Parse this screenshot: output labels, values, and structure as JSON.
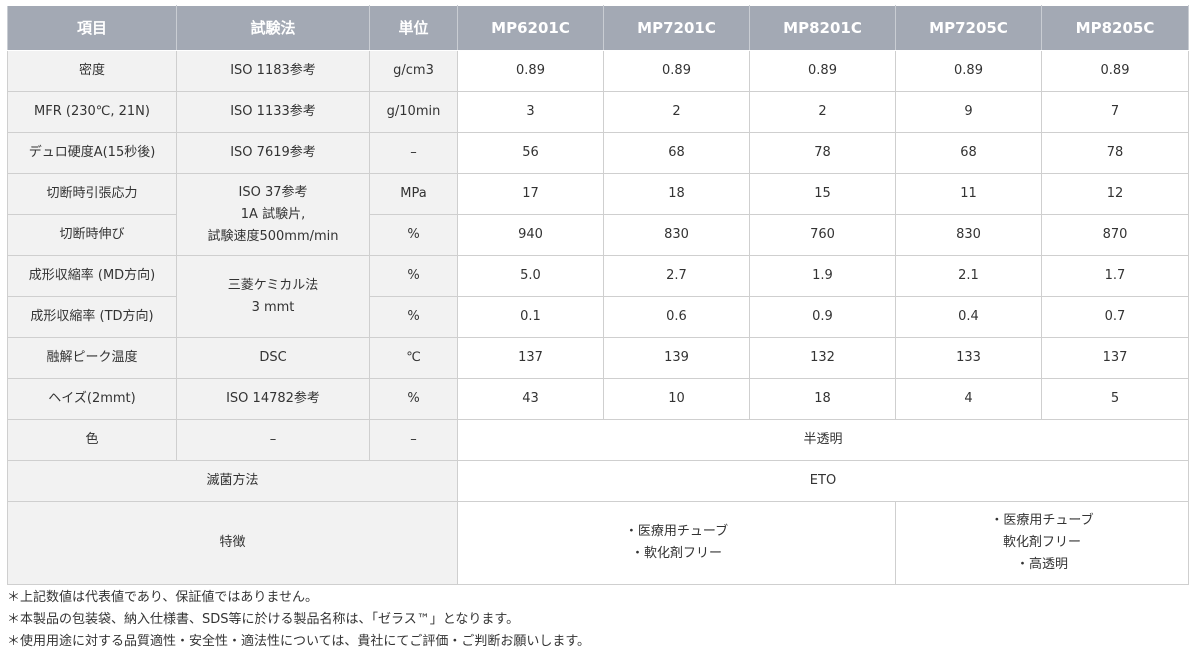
{
  "headers": [
    "項目",
    "試験法",
    "単位",
    "MP6201C",
    "MP7201C",
    "MP8201C",
    "MP7205C",
    "MP8205C"
  ],
  "rows": {
    "density": {
      "item": "密度",
      "method": "ISO 1183参考",
      "unit": "g/cm3",
      "values": [
        "0.89",
        "0.89",
        "0.89",
        "0.89",
        "0.89"
      ]
    },
    "mfr": {
      "item": "MFR (230℃, 21N)",
      "method": "ISO 1133参考",
      "unit": "g/10min",
      "values": [
        "3",
        "2",
        "2",
        "9",
        "7"
      ]
    },
    "hardness": {
      "item": "デュロ硬度A(15秒後)",
      "method": "ISO 7619参考",
      "unit": "–",
      "values": [
        "56",
        "68",
        "78",
        "68",
        "78"
      ]
    },
    "tensile": {
      "item": "切断時引張応力",
      "unit": "MPa",
      "values": [
        "17",
        "18",
        "15",
        "11",
        "12"
      ]
    },
    "elongation": {
      "item": "切断時伸び",
      "unit": "%",
      "values": [
        "940",
        "830",
        "760",
        "830",
        "870"
      ]
    },
    "tensile_method": {
      "line1": "ISO 37参考",
      "line2": "1A 試験片,",
      "line3": "試験速度500mm/min"
    },
    "shrink_md": {
      "item": "成形収縮率 (MD方向)",
      "unit": "%",
      "values": [
        "5.0",
        "2.7",
        "1.9",
        "2.1",
        "1.7"
      ]
    },
    "shrink_td": {
      "item": "成形収縮率 (TD方向)",
      "unit": "%",
      "values": [
        "0.1",
        "0.6",
        "0.9",
        "0.4",
        "0.7"
      ]
    },
    "shrink_method": {
      "line1": "三菱ケミカル法",
      "line2": "3 mmt"
    },
    "melt_peak": {
      "item": "融解ピーク温度",
      "method": "DSC",
      "unit": "℃",
      "values": [
        "137",
        "139",
        "132",
        "133",
        "137"
      ]
    },
    "haze": {
      "item": "ヘイズ(2mmt)",
      "method": "ISO 14782参考",
      "unit": "%",
      "values": [
        "43",
        "10",
        "18",
        "4",
        "5"
      ]
    },
    "color": {
      "item": "色",
      "method": "–",
      "unit": "–",
      "value": "半透明"
    },
    "sterilization": {
      "item": "滅菌方法",
      "value": "ETO"
    },
    "features": {
      "item": "特徴",
      "groupA": [
        "・医療用チューブ",
        "・軟化剤フリー"
      ],
      "groupB": [
        "・医療用チューブ",
        "軟化剤フリー",
        "・高透明"
      ]
    }
  },
  "notes": [
    "＊上記数値は代表値であり、保証値ではありません。",
    "＊本製品の包装袋、納入仕様書、SDS等に於ける製品名称は、「ゼラス™」となります。",
    "＊使用用途に対する品質適性・安全性・適法性については、貴社にてご評価・ご判断お願いします。"
  ]
}
